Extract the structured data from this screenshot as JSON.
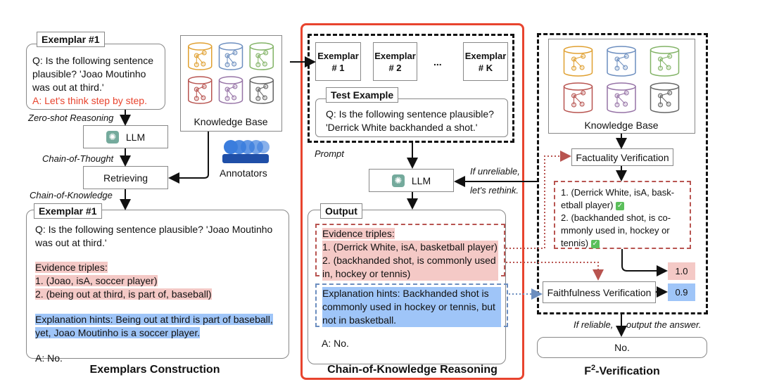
{
  "colors": {
    "accent_red": "#e8442e",
    "evidence_pink": "#f4c9c6",
    "hint_blue": "#9fc5f8",
    "red_text": "#e8442e"
  },
  "cylinder_colors": [
    "#e0a030",
    "#6c8ebf",
    "#82b366",
    "#b85450",
    "#9673a6",
    "#666666"
  ],
  "left": {
    "exemplar_top": {
      "label": "Exemplar #1",
      "question": "Q: Is the following sentence plausible? 'Joao Moutinho was out at third.'",
      "answer_prompt": "A: Let's think step by step."
    },
    "zero_shot_label": "Zero-shot Reasoning",
    "llm_label": "LLM",
    "cot_label": "Chain-of-Thought",
    "retrieving_label": "Retrieving",
    "cok_label": "Chain-of-Knowledge",
    "knowledge_base_label": "Knowledge Base",
    "annotators_label": "Annotators",
    "exemplar_full": {
      "label": "Exemplar #1",
      "question": "Q: Is the following sentence plausible? 'Joao Moutinho was out at third.'",
      "evidence_title": "Evidence triples:",
      "evidence_1": "1. (Joao, isA, soccer player)",
      "evidence_2": "2. (being out at third, is part of, baseball)",
      "hints": "Explanation hints: Being out at third is part of baseball, yet, Joao Moutinho is a soccer player.",
      "answer": "A: No."
    },
    "section_title": "Exemplars Construction"
  },
  "middle": {
    "docs": [
      {
        "line1": "Exemplar",
        "line2": "# 1"
      },
      {
        "line1": "Exemplar",
        "line2": "# 2"
      },
      {
        "line1": "Exemplar",
        "line2": "# K"
      }
    ],
    "ellipsis": "...",
    "test_label": "Test Example",
    "test_question": "Q: Is the following sentence plausible? 'Derrick White backhanded a shot.'",
    "prompt_label": "Prompt",
    "llm_label": "LLM",
    "unreliable_1": "If unreliable,",
    "unreliable_2": "let's rethink.",
    "output_label": "Output",
    "evidence_title": "Evidence triples:",
    "evidence_1": "1. (Derrick White, isA, basketball player)",
    "evidence_2": "2. (backhanded shot, is commonly used in, hockey or tennis)",
    "hints": "Explanation hints: Backhanded shot is commonly used in hockey or tennis, but not in basketball.",
    "answer": "A: No.",
    "section_title": "Chain-of-Knowledge Reasoning"
  },
  "right": {
    "knowledge_base_label": "Knowledge Base",
    "factuality_label": "Factuality Verification",
    "verified_1": "1. (Derrick White, isA, bask-etball player)",
    "verified_2": "2. (backhanded shot, is co-mmonly used in, hockey or tennis)",
    "factuality_score": "1.0",
    "faithfulness_label": "Faithfulness Verification",
    "faithfulness_score": "0.9",
    "reliable_1": "If reliable,",
    "reliable_2": "output the answer.",
    "final_answer": "No.",
    "section_title_prefix": "F",
    "section_title_sup": "2",
    "section_title_suffix": "-Verification"
  }
}
